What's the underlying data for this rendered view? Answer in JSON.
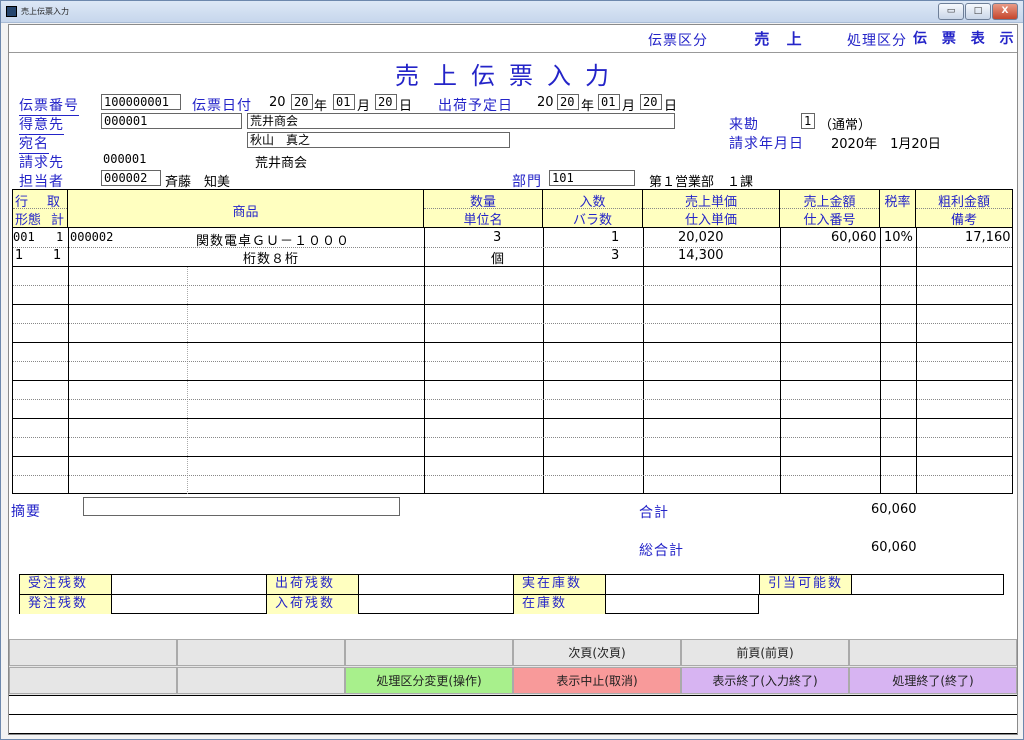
{
  "window": {
    "title": "売上伝票入力",
    "btn_min": "▭",
    "btn_max": "□",
    "btn_close": "X"
  },
  "header": {
    "slip_type_label": "伝票区分",
    "slip_type_value": "売 上",
    "process_label": "処理区分",
    "process_value": "伝 票 表 示",
    "page_title": "売上伝票入力"
  },
  "form": {
    "slip_no_label": "伝票番号",
    "slip_no": "100000001",
    "slip_date_label": "伝票日付",
    "slip_date_yy": "20",
    "slip_date_y2": "20",
    "slip_date_y": "年",
    "slip_date_m": "01",
    "slip_date_mu": "月",
    "slip_date_d": "20",
    "slip_date_du": "日",
    "ship_date_label": "出荷予定日",
    "ship_yy": "20",
    "ship_y2": "20",
    "ship_y": "年",
    "ship_m": "01",
    "ship_mu": "月",
    "ship_d": "20",
    "ship_du": "日",
    "customer_label": "得意先",
    "customer_code": "000001",
    "customer_name": "荒井商会",
    "addressee_label": "宛名",
    "addressee": "秋山　真之",
    "billto_label": "請求先",
    "billto_code": "000001",
    "billto_name": "荒井商会",
    "staff_label": "担当者",
    "staff_code": "000002",
    "staff_name": "斉藤　知美",
    "visit_label": "来勘",
    "visit_value": "1",
    "visit_note": "（通常）",
    "billing_label": "請求年月日",
    "billing_value": "2020年　1月20日",
    "dept_label": "部門",
    "dept_code": "101",
    "dept_name": "第１営業部　１課"
  },
  "grid": {
    "h_row_a": "行",
    "h_row_b": "取",
    "h_row_c": "形態",
    "h_row_d": "計",
    "h_item": "商品",
    "h_qty": "数量",
    "h_unit": "単位名",
    "h_per": "入数",
    "h_loose": "バラ数",
    "h_price": "売上単価",
    "h_cost": "仕入単価",
    "h_amount": "売上金額",
    "h_po": "仕入番号",
    "h_tax": "税率",
    "h_profit": "粗利金額",
    "h_note": "備考",
    "r1_line": "001",
    "r1_kind": "1",
    "r1_code": "000002",
    "r1_name": "関数電卓ＧＵ－１０００",
    "r1_qty": "3",
    "r1_per": "1",
    "r1_price": "20,020",
    "r1_amount": "60,060",
    "r1_tax": "10%",
    "r1_profit": "17,160",
    "r2_form": "1",
    "r2_calc": "1",
    "r2_desc": "桁数８桁",
    "r2_unit": "個",
    "r2_loose": "3",
    "r2_cost": "14,300"
  },
  "footer": {
    "memo_label": "摘要",
    "subtotal_label": "合計",
    "subtotal": "60,060",
    "total_label": "総合計",
    "total": "60,060",
    "order_rem": "受注残数",
    "ship_rem": "出荷残数",
    "real_stock": "実在庫数",
    "allocatable": "引当可能数",
    "po_rem": "発注残数",
    "recv_rem": "入荷残数",
    "stock": "在庫数"
  },
  "fkeys": {
    "next": "次頁(次頁)",
    "prev": "前頁(前頁)",
    "change": "処理区分変更(操作)",
    "cancel": "表示中止(取消)",
    "end_input": "表示終了(入力終了)",
    "quit": "処理終了(終了)"
  },
  "colors": {
    "label_blue": "#2424c8",
    "header_yellow": "#ffffc0",
    "btn_green": "#a8f08c",
    "btn_red": "#f89a9a",
    "btn_violet": "#d7b4f2"
  }
}
